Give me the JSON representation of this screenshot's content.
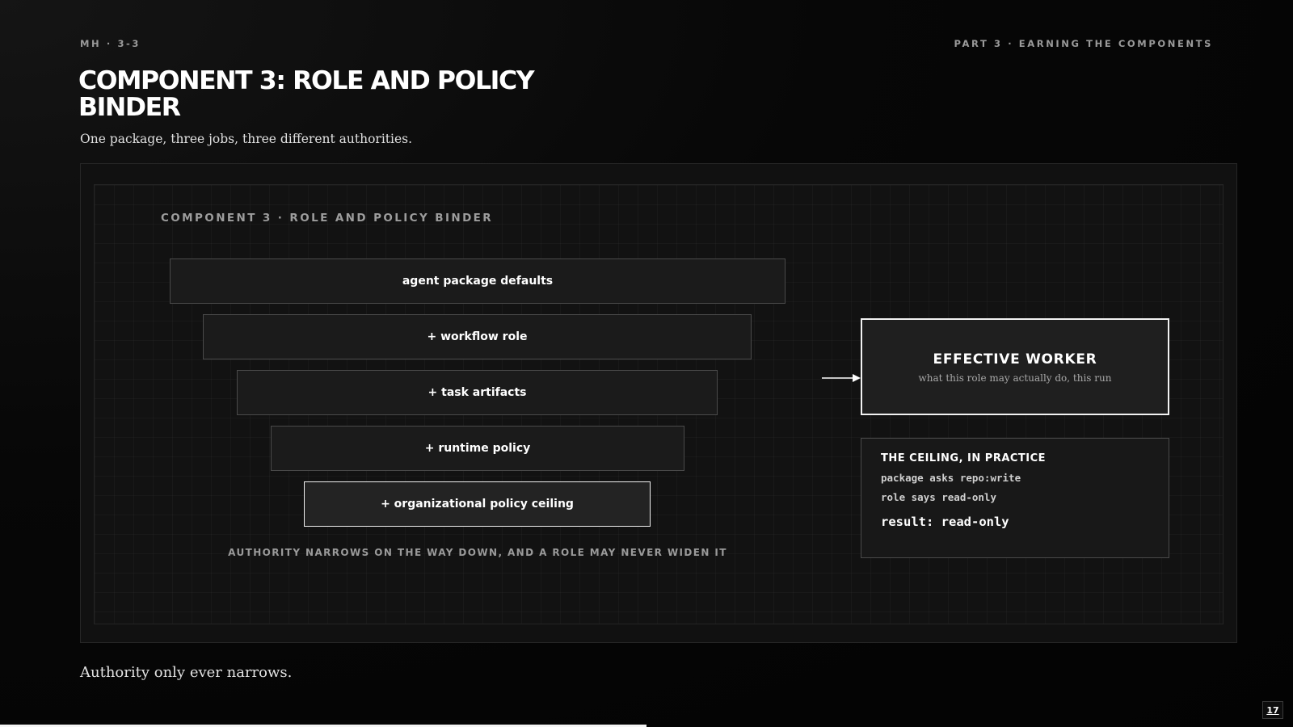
{
  "header": {
    "kicker_left": "MH · 3-3",
    "kicker_right": "PART 3 · EARNING THE COMPONENTS"
  },
  "slide": {
    "title": "COMPONENT 3: ROLE AND POLICY BINDER",
    "subtitle": "One package, three jobs, three different authorities.",
    "takeaway": "Authority only ever narrows.",
    "page_number": "17"
  },
  "diagram": {
    "label": "COMPONENT 3 · ROLE AND POLICY BINDER",
    "layers": [
      "agent package defaults",
      "+ workflow role",
      "+ task artifacts",
      "+ runtime policy",
      "+ organizational policy ceiling"
    ],
    "caption": "AUTHORITY NARROWS ON THE WAY DOWN, AND A ROLE MAY NEVER WIDEN IT",
    "effective": {
      "title": "EFFECTIVE WORKER",
      "subtitle": "what this role may actually do, this run"
    },
    "ceiling_card": {
      "title": "THE CEILING, IN PRACTICE",
      "lines": [
        "package asks repo:write",
        "role says read-only"
      ],
      "result": "result: read-only"
    }
  },
  "colors": {
    "background": "#050505",
    "panel": "#111111",
    "accent": "#ffffff",
    "muted": "#9a9a9a"
  }
}
